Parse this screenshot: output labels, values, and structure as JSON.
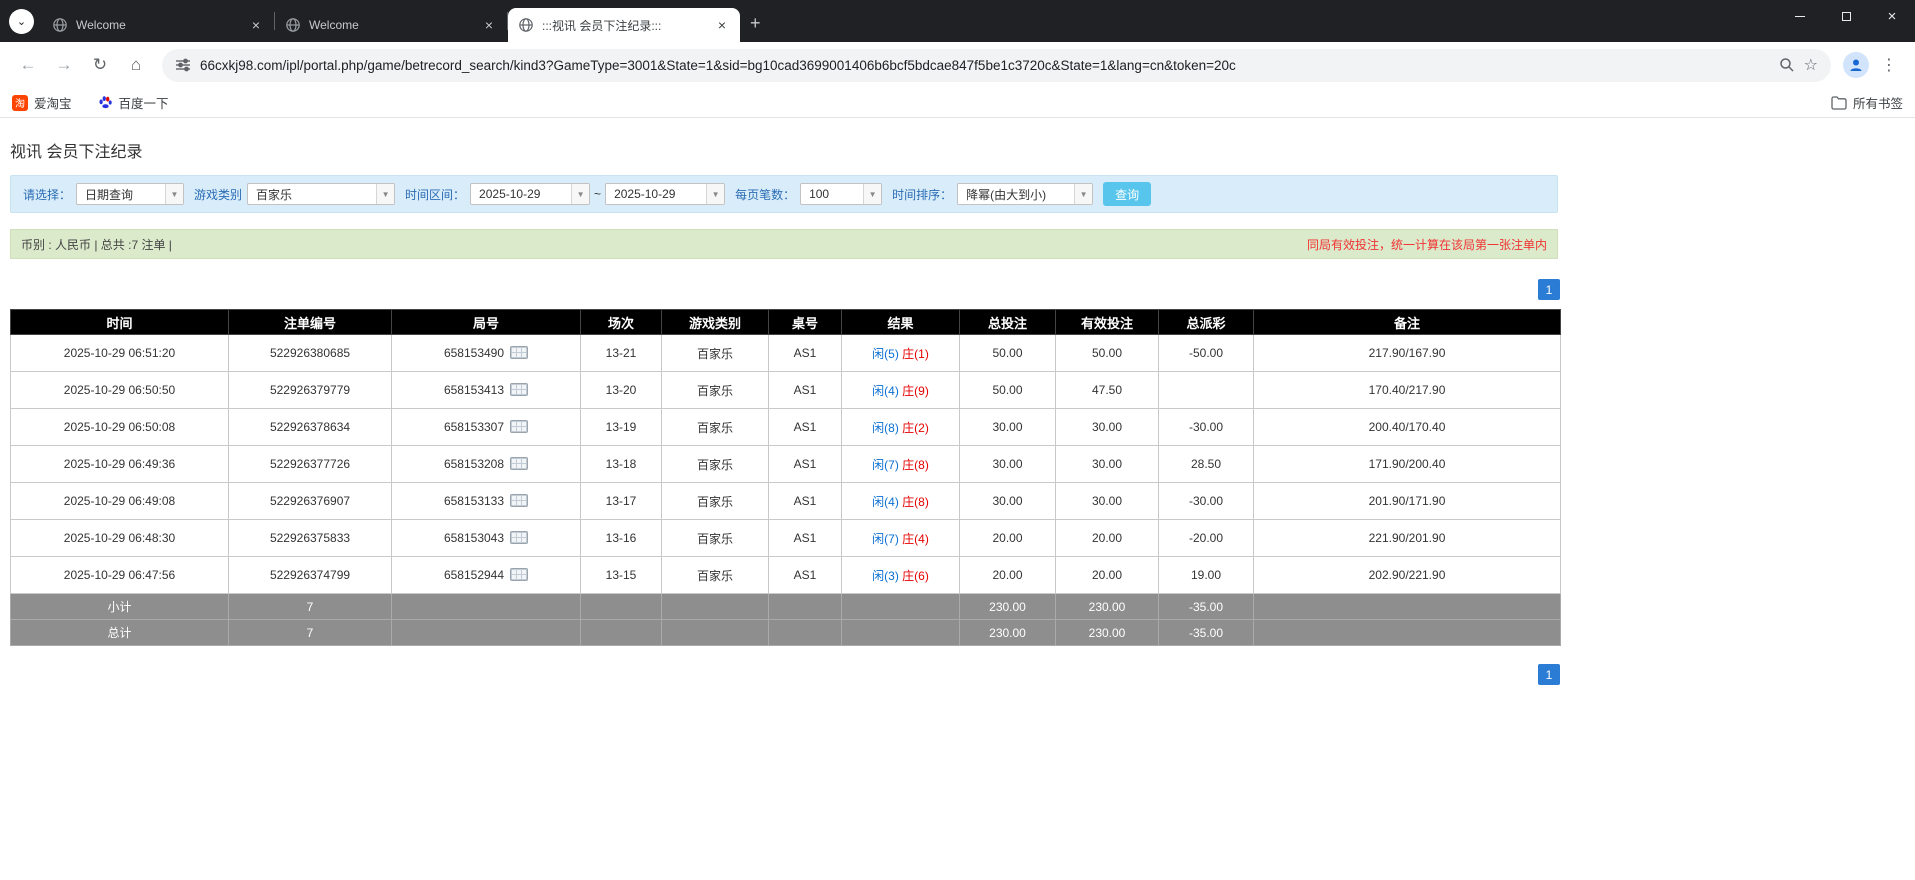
{
  "browser": {
    "tabs": [
      {
        "title": "Welcome"
      },
      {
        "title": "Welcome"
      },
      {
        "title": ":::视讯 会员下注纪录:::"
      }
    ],
    "new_tab_label": "+",
    "url": "66cxkj98.com/ipl/portal.php/game/betrecord_search/kind3?GameType=3001&State=1&sid=bg10cad3699001406b6bcf5bdcae847f5be1c3720c&State=1&lang=cn&token=20c",
    "bookmarks": {
      "item1": "爱淘宝",
      "item1_glyph": "淘",
      "item2": "百度一下",
      "all_bookmarks": "所有书签"
    },
    "close_glyph": "×",
    "menu_dots_glyph": "⋮",
    "back_glyph": "←",
    "forward_glyph": "→",
    "reload_glyph": "↻",
    "home_glyph": "⌂",
    "star_glyph": "☆",
    "tab_search_glyph": "⌄",
    "combo_arrow_glyph": "▼"
  },
  "page": {
    "title": "视讯 会员下注纪录",
    "filters": {
      "select_label": "请选择：",
      "select_value": "日期查询",
      "game_type_label": "游戏类别",
      "game_type_value": "百家乐",
      "date_range_label": "时间区间：",
      "date_from": "2025-10-29",
      "tilde": "~",
      "date_to": "2025-10-29",
      "page_size_label": "每页笔数：",
      "page_size_value": "100",
      "sort_label": "时间排序：",
      "sort_value": "降幂(由大到小)",
      "search_button": "查询"
    },
    "summary_bar": {
      "left": "币别 : 人民币 | 总共 :7 注单 |",
      "right": "同局有效投注，统一计算在该局第一张注单内"
    },
    "pagination": {
      "page": "1"
    },
    "table": {
      "headers": [
        "时间",
        "注单编号",
        "局号",
        "场次",
        "游戏类别",
        "桌号",
        "结果",
        "总投注",
        "有效投注",
        "总派彩",
        "备注"
      ],
      "rows": [
        {
          "time": "2025-10-29 06:51:20",
          "bet_id": "522926380685",
          "round_id": "658153490",
          "session": "13-21",
          "game": "百家乐",
          "table_no": "AS1",
          "result_player": "闲(5)",
          "result_banker": "庄(1)",
          "total_bet": "50.00",
          "valid_bet": "50.00",
          "payout": "-50.00",
          "payout_class": "neg",
          "note": "217.90/167.90"
        },
        {
          "time": "2025-10-29 06:50:50",
          "bet_id": "522926379779",
          "round_id": "658153413",
          "session": "13-20",
          "game": "百家乐",
          "table_no": "AS1",
          "result_player": "闲(4)",
          "result_banker": "庄(9)",
          "total_bet": "50.00",
          "valid_bet": "47.50",
          "payout": "",
          "payout_class": "",
          "note": "170.40/217.90"
        },
        {
          "time": "2025-10-29 06:50:08",
          "bet_id": "522926378634",
          "round_id": "658153307",
          "session": "13-19",
          "game": "百家乐",
          "table_no": "AS1",
          "result_player": "闲(8)",
          "result_banker": "庄(2)",
          "total_bet": "30.00",
          "valid_bet": "30.00",
          "payout": "-30.00",
          "payout_class": "neg",
          "note": "200.40/170.40"
        },
        {
          "time": "2025-10-29 06:49:36",
          "bet_id": "522926377726",
          "round_id": "658153208",
          "session": "13-18",
          "game": "百家乐",
          "table_no": "AS1",
          "result_player": "闲(7)",
          "result_banker": "庄(8)",
          "total_bet": "30.00",
          "valid_bet": "30.00",
          "payout": "28.50",
          "payout_class": "",
          "note": "171.90/200.40"
        },
        {
          "time": "2025-10-29 06:49:08",
          "bet_id": "522926376907",
          "round_id": "658153133",
          "session": "13-17",
          "game": "百家乐",
          "table_no": "AS1",
          "result_player": "闲(4)",
          "result_banker": "庄(8)",
          "total_bet": "30.00",
          "valid_bet": "30.00",
          "payout": "-30.00",
          "payout_class": "neg",
          "note": "201.90/171.90"
        },
        {
          "time": "2025-10-29 06:48:30",
          "bet_id": "522926375833",
          "round_id": "658153043",
          "session": "13-16",
          "game": "百家乐",
          "table_no": "AS1",
          "result_player": "闲(7)",
          "result_banker": "庄(4)",
          "total_bet": "20.00",
          "valid_bet": "20.00",
          "payout": "-20.00",
          "payout_class": "neg",
          "note": "221.90/201.90"
        },
        {
          "time": "2025-10-29 06:47:56",
          "bet_id": "522926374799",
          "round_id": "658152944",
          "session": "13-15",
          "game": "百家乐",
          "table_no": "AS1",
          "result_player": "闲(3)",
          "result_banker": "庄(6)",
          "total_bet": "20.00",
          "valid_bet": "20.00",
          "payout": "19.00",
          "payout_class": "",
          "note": "202.90/221.90"
        }
      ],
      "subtotal": {
        "label": "小计",
        "count": "7",
        "total_bet": "230.00",
        "valid_bet": "230.00",
        "payout": "-35.00",
        "payout_class": "neg"
      },
      "total": {
        "label": "总计",
        "count": "7",
        "total_bet": "230.00",
        "valid_bet": "230.00",
        "payout": "-35.00",
        "payout_class": "neg"
      }
    }
  }
}
